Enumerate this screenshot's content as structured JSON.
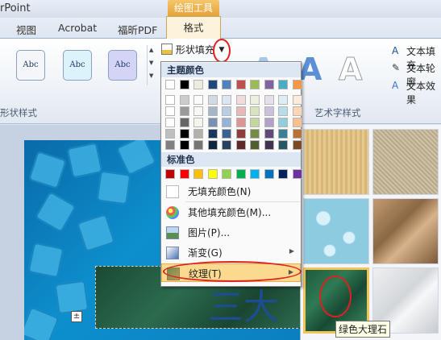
{
  "window": {
    "title": "rPoint"
  },
  "context_tab": {
    "label": "绘图工具"
  },
  "tabs": [
    {
      "label": "视图"
    },
    {
      "label": "Acrobat"
    },
    {
      "label": "福昕PDF"
    },
    {
      "label": "格式"
    }
  ],
  "ribbon": {
    "shape_style_sample": "Abc",
    "shape_styles_group": "形状样式",
    "fill_button": "形状填充",
    "wordart_group": "艺术字样式",
    "wordart_glyph": "A",
    "text_fill": "文本填充",
    "text_outline": "文本轮廓",
    "text_effects": "文本效果"
  },
  "menu": {
    "theme_colors_header": "主题颜色",
    "standard_colors_header": "标准色",
    "theme_top_row": [
      "#ffffff",
      "#000000",
      "#eeece1",
      "#1f497d",
      "#4f81bd",
      "#c0504d",
      "#9bbb59",
      "#8064a2",
      "#4bacc6",
      "#f79646"
    ],
    "standard_colors": [
      "#c00000",
      "#ff0000",
      "#ffc000",
      "#ffff00",
      "#92d050",
      "#00b050",
      "#00b0f0",
      "#0070c0",
      "#002060",
      "#7030a0"
    ],
    "items": [
      {
        "label": "无填充颜色(N)"
      },
      {
        "label": "其他填充颜色(M)..."
      },
      {
        "label": "图片(P)..."
      },
      {
        "label": "渐变(G)"
      },
      {
        "label": "纹理(T)"
      }
    ]
  },
  "slide": {
    "title_fragment": "三大"
  },
  "texture_tooltip": "绿色大理石",
  "colors": {
    "highlight": "#fbd98f",
    "annotation_red": "#e02020",
    "context_tab": "#e4a23a"
  }
}
